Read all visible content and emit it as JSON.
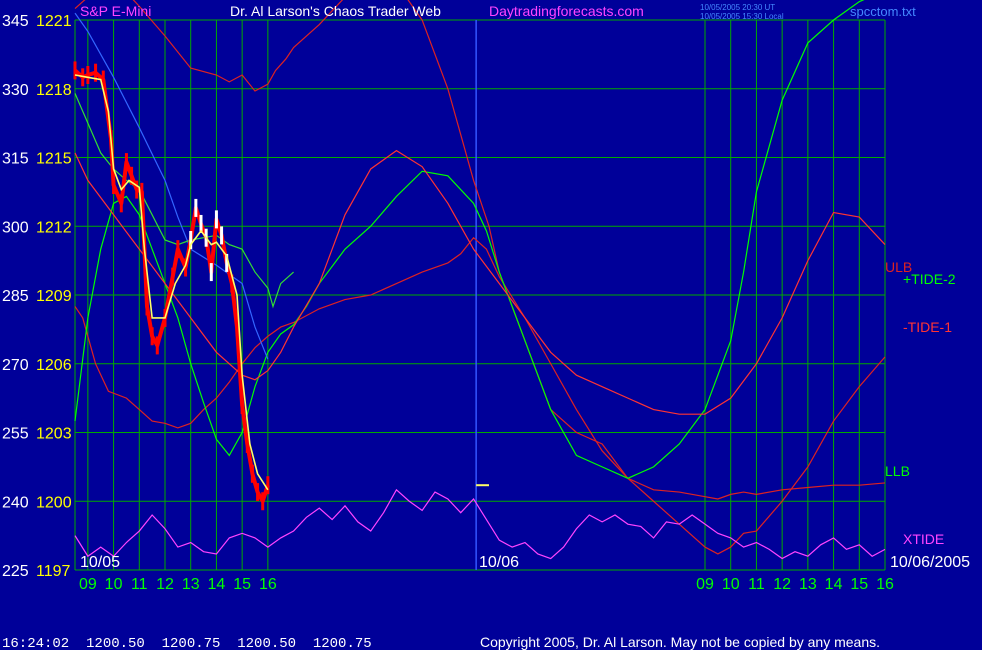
{
  "header": {
    "instrument": "S&P E-Mini",
    "title": "Dr. Al Larson's Chaos Trader Web",
    "site": "Daytradingforecasts.com",
    "timestamp_line1": "10/05/2005 20:30 UT",
    "timestamp_line2": "10/05/2005 15:30 Local",
    "filename": "spcctom.txt"
  },
  "footer": {
    "quote": "16:24:02  1200.50  1200.75  1200.50  1200.75",
    "copyright": "Copyright 2005, Dr. Al Larson. May not be copied by any means."
  },
  "colors": {
    "background": "#000099",
    "grid": "#00aa00",
    "price_axis": "#ffff00",
    "tide_axis": "#ffffff",
    "time_axis": "#00ff00",
    "price_bars": "#ff0000",
    "price_bars_highlight": "#ffffff",
    "average": "#ffff66",
    "ulb_llb": "#dd2222",
    "plus_tide": "#00ff00",
    "minus_tide": "#ff3333",
    "xtide": "#ff44ff",
    "blue_line": "#3366ff",
    "green_mean": "#33dd33"
  },
  "chart_data": {
    "type": "line",
    "title": "Dr. Al Larson's Chaos Trader Web",
    "instrument": "S&P E-Mini",
    "y_left_ticks": [
      "345",
      "330",
      "315",
      "300",
      "285",
      "270",
      "255",
      "240",
      "225"
    ],
    "y_left_range": [
      225,
      345
    ],
    "y_price_ticks": [
      "1221",
      "1218",
      "1215",
      "1212",
      "1209",
      "1206",
      "1203",
      "1200",
      "1197"
    ],
    "y_price_range": [
      1197,
      1221
    ],
    "x_ticks": [
      "09",
      "10",
      "11",
      "12",
      "13",
      "14",
      "15",
      "16",
      "09",
      "10",
      "11",
      "12",
      "13",
      "14",
      "15",
      "16"
    ],
    "date_labels": [
      "10/05",
      "10/06",
      "10/06/2005"
    ],
    "x_range_hours": [
      8.5,
      40
    ],
    "now_marker_hour": 24.1,
    "grid": true,
    "series": [
      {
        "name": "ULB",
        "key": "ulb",
        "color_key": "ulb_llb",
        "x": [
          8.5,
          9,
          10,
          10.5,
          11,
          12,
          13,
          14,
          14.5,
          15,
          15.5,
          16,
          16.3,
          16.7,
          17,
          18,
          19,
          20,
          21,
          22,
          23,
          23.5,
          24,
          24.6,
          25,
          26,
          27,
          28,
          29,
          30,
          31,
          32,
          33,
          33.5,
          34,
          34.5,
          35,
          36,
          37,
          38,
          39,
          40
        ],
        "y": [
          1221.5,
          1222,
          1222.5,
          1222.2,
          1221.6,
          1220.3,
          1218.9,
          1218.6,
          1218.3,
          1218.6,
          1217.9,
          1218.2,
          1218.8,
          1219.3,
          1219.8,
          1220.8,
          1222,
          1223,
          1222.6,
          1221,
          1218,
          1216,
          1214,
          1212,
          1210,
          1207,
          1204,
          1203,
          1202.5,
          1201,
          1200,
          1199,
          1198,
          1197.7,
          1198,
          1198.6,
          1198.7,
          1200,
          1201.5,
          1203.5,
          1205,
          1206.3
        ]
      },
      {
        "name": "LLB",
        "key": "llb",
        "color_key": "ulb_llb",
        "x": [
          8.5,
          8.8,
          9.3,
          9.8,
          10.5,
          11,
          11.5,
          12,
          12.5,
          13,
          13.5,
          14,
          14.5,
          15,
          15.5,
          16,
          16.5,
          17,
          18,
          19,
          20,
          21,
          22,
          23,
          23.5,
          24,
          24.5,
          25,
          26,
          27,
          28,
          29,
          30,
          31,
          32,
          33,
          33.5,
          34,
          34.5,
          35,
          36,
          37,
          38,
          39,
          40
        ],
        "y": [
          1208.5,
          1208,
          1206,
          1204.8,
          1204.5,
          1204,
          1203.5,
          1203.4,
          1203.2,
          1203.4,
          1204,
          1204.5,
          1205.2,
          1206,
          1206.7,
          1207.2,
          1207.6,
          1207.8,
          1208.4,
          1208.8,
          1209,
          1209.5,
          1210,
          1210.4,
          1210.8,
          1211.5,
          1211,
          1209.8,
          1208,
          1206,
          1204,
          1202.2,
          1201,
          1200.5,
          1200.4,
          1200.2,
          1200.1,
          1200.3,
          1200.4,
          1200.3,
          1200.5,
          1200.6,
          1200.7,
          1200.7,
          1200.8
        ]
      },
      {
        "name": "+TIDE-2",
        "key": "ptide",
        "color_key": "plus_tide",
        "x": [
          8.5,
          9,
          9.5,
          10,
          10.5,
          11,
          11.5,
          12,
          12.5,
          13,
          13.5,
          14,
          14.5,
          15,
          15.5,
          16,
          16.5,
          17,
          17.5,
          18,
          19,
          20,
          21,
          22,
          23,
          24,
          24.5,
          25,
          26,
          27,
          28,
          29,
          30,
          31,
          32,
          33,
          34,
          34.5,
          35,
          36,
          37,
          38,
          39,
          40
        ],
        "y": [
          1203.5,
          1208,
          1211,
          1213,
          1213.3,
          1212.5,
          1211,
          1209.5,
          1208,
          1206,
          1204.3,
          1202.7,
          1202,
          1203,
          1205,
          1206.5,
          1207.3,
          1207.7,
          1208.5,
          1209.5,
          1211,
          1212,
          1213.3,
          1214.4,
          1214.2,
          1213,
          1211.8,
          1210,
          1207,
          1204,
          1202,
          1201.5,
          1201,
          1201.5,
          1202.5,
          1204,
          1207,
          1210,
          1213.5,
          1217.5,
          1220,
          1221,
          1221.8,
          1222.3
        ]
      },
      {
        "name": "-TIDE-1",
        "key": "mtide",
        "color_key": "minus_tide",
        "x": [
          8.5,
          9,
          10,
          11,
          12,
          13,
          14,
          15,
          15.5,
          16,
          16.5,
          17,
          18,
          18.5,
          19,
          20,
          21,
          22,
          23,
          24,
          25,
          26,
          27,
          28,
          29,
          30,
          31,
          32,
          33,
          34,
          35,
          36,
          37,
          38,
          39,
          40
        ],
        "y": [
          1215.2,
          1214,
          1212.5,
          1211,
          1209.5,
          1208,
          1206.5,
          1205.5,
          1205.3,
          1205.7,
          1206.5,
          1207.6,
          1209.5,
          1211,
          1212.5,
          1214.5,
          1215.3,
          1214.6,
          1213,
          1211,
          1209.5,
          1208,
          1206.5,
          1205.5,
          1205,
          1204.5,
          1204,
          1203.8,
          1203.8,
          1204.5,
          1206,
          1208,
          1210.5,
          1212.6,
          1212.4,
          1211.2
        ]
      },
      {
        "name": "XTIDE",
        "key": "xtide",
        "color_key": "xtide",
        "x": [
          8.5,
          9,
          9.5,
          10,
          10.5,
          11,
          11.5,
          12,
          12.5,
          13,
          13.5,
          14,
          14.5,
          15,
          15.5,
          16,
          16.5,
          17,
          17.5,
          18,
          18.5,
          19,
          19.5,
          20,
          20.5,
          21,
          21.5,
          22,
          22.5,
          23,
          23.5,
          24,
          24.5,
          25,
          25.5,
          26,
          26.5,
          27,
          27.5,
          28,
          28.5,
          29,
          29.5,
          30,
          30.5,
          31,
          31.5,
          32,
          32.5,
          33,
          33.5,
          34,
          34.5,
          35,
          35.5,
          36,
          36.5,
          37,
          37.5,
          38,
          38.5,
          39,
          39.5,
          40
        ],
        "y": [
          1198.5,
          1197.6,
          1198,
          1197.6,
          1198.2,
          1198.7,
          1199.4,
          1198.8,
          1198,
          1198.2,
          1197.8,
          1197.7,
          1198.4,
          1198.6,
          1198.4,
          1198,
          1198.4,
          1198.7,
          1199.3,
          1199.7,
          1199.2,
          1199.8,
          1199.1,
          1198.7,
          1199.5,
          1200.5,
          1200,
          1199.6,
          1200.4,
          1200.1,
          1199.5,
          1200.1,
          1199.2,
          1198.3,
          1198,
          1198.2,
          1197.7,
          1197.5,
          1198,
          1198.8,
          1199.4,
          1199.1,
          1199.4,
          1199,
          1198.9,
          1198.4,
          1199.1,
          1199,
          1199.4,
          1199,
          1198.6,
          1198.4,
          1198,
          1198.2,
          1197.9,
          1197.5,
          1197.8,
          1197.6,
          1198.1,
          1198.4,
          1197.9,
          1198.1,
          1197.6,
          1197.9
        ]
      },
      {
        "name": "blue",
        "key": "blue",
        "color_key": "blue_line",
        "x": [
          8.5,
          9,
          10,
          11,
          12,
          12.5,
          13,
          14,
          15,
          15.5,
          16
        ],
        "y": [
          1221.3,
          1220.5,
          1218.5,
          1216.3,
          1214,
          1212.4,
          1211,
          1210.3,
          1209.5,
          1207.6,
          1206.2
        ]
      },
      {
        "name": "mean",
        "key": "mean",
        "color_key": "green_mean",
        "x": [
          8.5,
          9,
          9.5,
          10,
          10.5,
          11,
          11.5,
          12,
          12.5,
          13,
          13.5,
          14,
          14.5,
          15,
          15.5,
          16,
          16.2,
          16.5,
          17
        ],
        "y": [
          1217.8,
          1216.5,
          1215.2,
          1214.5,
          1214,
          1213.6,
          1212.5,
          1211.4,
          1211.2,
          1211.4,
          1211.5,
          1211.6,
          1211.2,
          1211,
          1210,
          1209.3,
          1208.5,
          1209.5,
          1210
        ]
      },
      {
        "name": "price",
        "key": "price",
        "color_key": "price_bars",
        "x": [
          8.5,
          8.8,
          9,
          9.3,
          9.6,
          9.9,
          10,
          10.3,
          10.5,
          10.7,
          10.9,
          11.1,
          11.3,
          11.5,
          11.7,
          12,
          12.3,
          12.5,
          12.8,
          13,
          13.2,
          13.4,
          13.6,
          13.8,
          14,
          14.2,
          14.4,
          14.6,
          14.8,
          15,
          15.2,
          15.4,
          15.6,
          15.8,
          16
        ],
        "y": [
          1218.8,
          1218.5,
          1218.6,
          1218.7,
          1218.4,
          1215.8,
          1213.8,
          1213,
          1214.8,
          1214.2,
          1213.6,
          1213.5,
          1208.5,
          1207.2,
          1206.8,
          1208,
          1209.8,
          1211,
          1210.2,
          1211.4,
          1212.8,
          1212.1,
          1211.5,
          1210,
          1212.3,
          1211.6,
          1210.4,
          1209.5,
          1207.6,
          1204.2,
          1202.5,
          1201.2,
          1200.4,
          1200,
          1200.7
        ]
      },
      {
        "name": "average",
        "key": "avg",
        "color_key": "average",
        "x": [
          8.5,
          9,
          9.5,
          9.8,
          10,
          10.3,
          10.6,
          11,
          11.2,
          11.5,
          12,
          12.4,
          12.8,
          13,
          13.4,
          13.8,
          14,
          14.4,
          14.8,
          15,
          15.3,
          15.6,
          16
        ],
        "y": [
          1218.6,
          1218.5,
          1218.4,
          1217,
          1214.5,
          1213.6,
          1214,
          1213.7,
          1211,
          1208,
          1208,
          1209.5,
          1210.3,
          1211.2,
          1211.8,
          1211.2,
          1211.3,
          1210.7,
          1209,
          1205.5,
          1202.5,
          1201.2,
          1200.5
        ]
      }
    ],
    "labels": [
      {
        "text": "ULB",
        "color_key": "ulb_llb"
      },
      {
        "text": "+TIDE-2",
        "color_key": "plus_tide"
      },
      {
        "text": "-TIDE-1",
        "color_key": "minus_tide"
      },
      {
        "text": "LLB",
        "color_key": "plus_tide"
      },
      {
        "text": "XTIDE",
        "color_key": "xtide"
      }
    ]
  }
}
